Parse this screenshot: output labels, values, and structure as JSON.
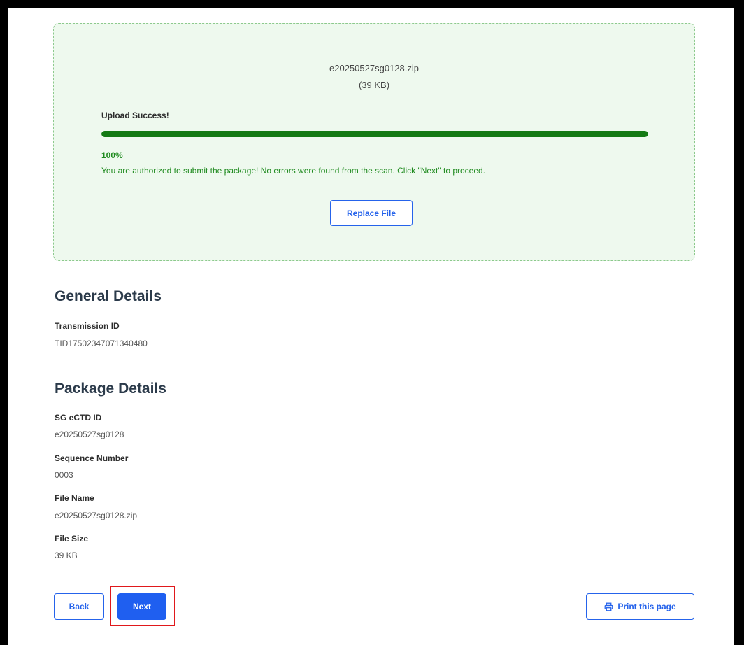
{
  "upload": {
    "file_name": "e20250527sg0128.zip",
    "file_size": "(39 KB)",
    "status": "Upload Success!",
    "progress_percent": 100,
    "progress_label": "100%",
    "message": "You are authorized to submit the package! No errors were found from the scan. Click \"Next\" to proceed.",
    "replace_label": "Replace File"
  },
  "general": {
    "title": "General Details",
    "fields": [
      {
        "label": "Transmission ID",
        "value": "TID17502347071340480"
      }
    ]
  },
  "package": {
    "title": "Package Details",
    "fields": [
      {
        "label": "SG eCTD ID",
        "value": "e20250527sg0128"
      },
      {
        "label": "Sequence Number",
        "value": "0003"
      },
      {
        "label": "File Name",
        "value": "e20250527sg0128.zip"
      },
      {
        "label": "File Size",
        "value": "39 KB"
      }
    ]
  },
  "actions": {
    "back_label": "Back",
    "next_label": "Next",
    "print_label": "Print this page",
    "print_icon": "printer-icon"
  },
  "colors": {
    "accent": "#2563eb",
    "primary_button": "#1f5ff0",
    "success": "#147a14",
    "success_bg": "#eef9ee",
    "highlight": "#e0181b"
  }
}
